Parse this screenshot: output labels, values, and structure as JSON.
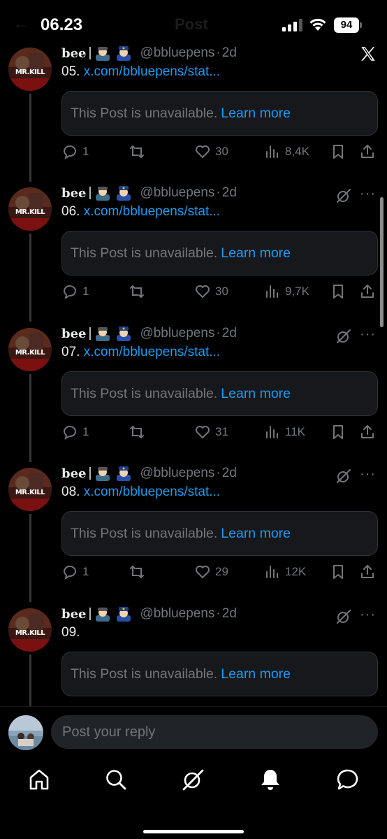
{
  "status_bar": {
    "time": "06.23",
    "battery": "94",
    "header_title": "Post"
  },
  "top_logo": "X",
  "posts": [
    {
      "display_name": "bee",
      "handle": "@bbluepens",
      "time": "2d",
      "number": "05.",
      "link": "x.com/bbluepens/stat...",
      "unavailable_text": "This Post is unavailable.",
      "learn_more": "Learn more",
      "replies": "1",
      "likes": "30",
      "views": "8,4K"
    },
    {
      "display_name": "bee",
      "handle": "@bbluepens",
      "time": "2d",
      "number": "06.",
      "link": "x.com/bbluepens/stat...",
      "unavailable_text": "This Post is unavailable.",
      "learn_more": "Learn more",
      "replies": "1",
      "likes": "30",
      "views": "9,7K"
    },
    {
      "display_name": "bee",
      "handle": "@bbluepens",
      "time": "2d",
      "number": "07.",
      "link": "x.com/bbluepens/stat...",
      "unavailable_text": "This Post is unavailable.",
      "learn_more": "Learn more",
      "replies": "1",
      "likes": "31",
      "views": "11K"
    },
    {
      "display_name": "bee",
      "handle": "@bbluepens",
      "time": "2d",
      "number": "08.",
      "link": "x.com/bbluepens/stat...",
      "unavailable_text": "This Post is unavailable.",
      "learn_more": "Learn more",
      "replies": "1",
      "likes": "29",
      "views": "12K"
    },
    {
      "display_name": "bee",
      "handle": "@bbluepens",
      "time": "2d",
      "number": "09.",
      "link": "",
      "unavailable_text": "This Post is unavailable.",
      "learn_more": "Learn more",
      "replies": "",
      "likes": "",
      "views": ""
    }
  ],
  "avatar_text": "MR.KILL",
  "reply": {
    "placeholder": "Post your reply"
  },
  "tabs": [
    {
      "icon": "home-icon"
    },
    {
      "icon": "search-icon"
    },
    {
      "icon": "grok-icon"
    },
    {
      "icon": "bell-icon"
    },
    {
      "icon": "messages-icon"
    }
  ],
  "colors": {
    "accent": "#1d9bf0",
    "background": "#000000",
    "secondary_text": "#71767b",
    "card_background": "#16181c"
  }
}
